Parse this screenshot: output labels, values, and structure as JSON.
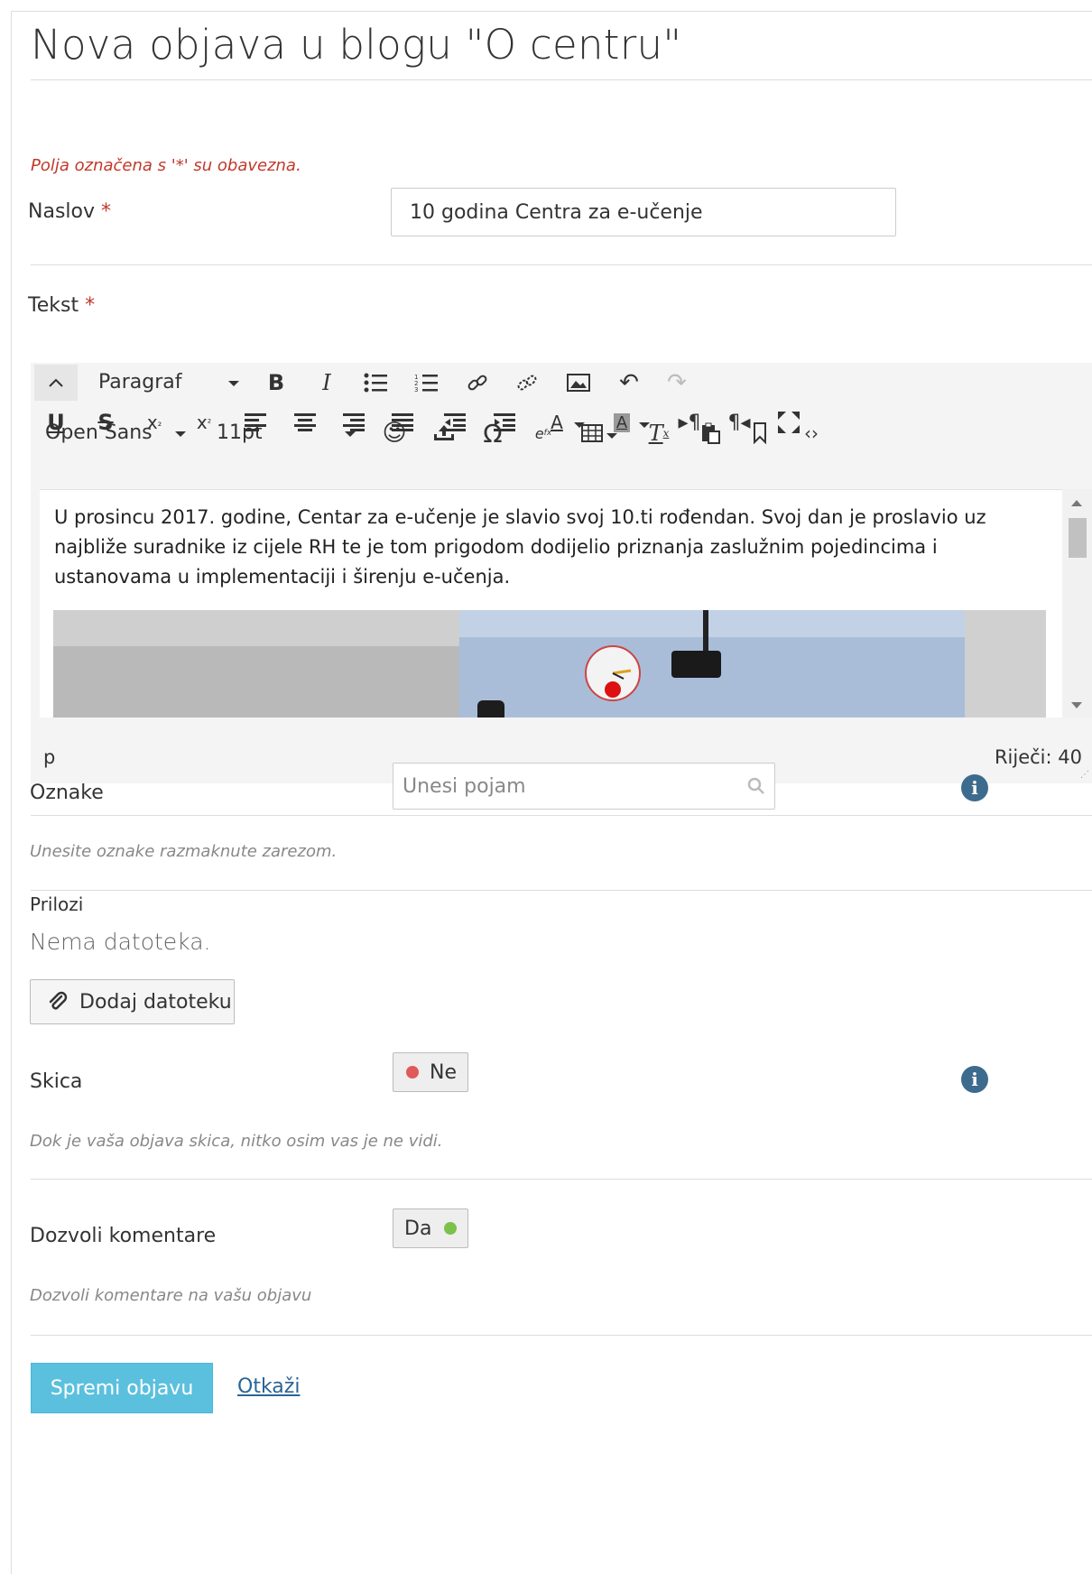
{
  "page": {
    "title": "Nova objava u blogu \"O centru\"",
    "required_note": "Polja označena s '*' su obavezna."
  },
  "fields": {
    "naslov": {
      "label": "Naslov",
      "star": "*",
      "value": "10 godina Centra za e-učenje"
    },
    "tekst": {
      "label": "Tekst",
      "star": "*"
    },
    "oznake": {
      "label": "Oznake",
      "placeholder": "Unesi pojam",
      "help": "Unesite oznake razmaknute zarezom."
    },
    "prilozi": {
      "label": "Prilozi",
      "empty": "Nema datoteka.",
      "add_button": "Dodaj datoteku"
    },
    "skica": {
      "label": "Skica",
      "toggle": "Ne",
      "toggle_color": "#e05a5a",
      "help": "Dok je vaša objava skica, nitko osim vas je ne vidi."
    },
    "komentari": {
      "label": "Dozvoli komentare",
      "toggle": "Da",
      "toggle_color": "#7cc24a",
      "help": "Dozvoli komentare na vašu objavu"
    }
  },
  "editor": {
    "block_format": "Paragraf",
    "font_family": "Open Sans",
    "font_size": "11pt",
    "content": "U prosincu 2017. godine, Centar za e-učenje je slavio svoj 10.ti rođendan. Svoj dan je proslavio uz najbliže suradnike iz cijele RH te je tom prigodom dodijelio priznanja zaslužnim pojedincima i ustanovama u implementaciji i širenju e-učenja.",
    "path": "p",
    "word_count": "Riječi: 40",
    "icons": {
      "row1": [
        "collapse-icon",
        "bold-icon",
        "italic-icon",
        "bullet-list-icon",
        "numbered-list-icon",
        "link-icon",
        "unlink-icon",
        "image-icon",
        "undo-icon",
        "redo-icon"
      ],
      "row2": [
        "underline-icon",
        "strikethrough-icon",
        "subscript-icon",
        "superscript-icon",
        "align-left-icon",
        "align-center-icon",
        "align-right-icon",
        "align-justify-icon",
        "outdent-icon",
        "indent-icon",
        "text-color-icon",
        "background-color-icon",
        "ltr-icon",
        "rtl-icon",
        "fullscreen-icon"
      ],
      "row3": [
        "emoticon-icon",
        "upload-icon",
        "omega-icon",
        "equation-icon",
        "table-icon",
        "clear-format-icon",
        "paste-icon",
        "bookmark-icon",
        "code-icon"
      ]
    }
  },
  "actions": {
    "save": "Spremi objavu",
    "cancel": "Otkaži"
  }
}
